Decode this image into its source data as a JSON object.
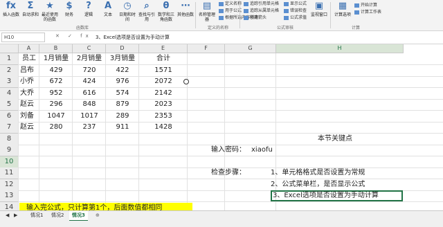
{
  "ribbon": {
    "buttons": [
      {
        "icon": "insert-function-icon",
        "glyph": "fx",
        "label": "插入函数"
      },
      {
        "icon": "autosum-icon",
        "glyph": "Σ",
        "label": "自动求和"
      },
      {
        "icon": "recent-functions-icon",
        "glyph": "★",
        "label": "最近使用的函数"
      },
      {
        "icon": "financial-icon",
        "glyph": "$",
        "label": "财务"
      },
      {
        "icon": "logical-icon",
        "glyph": "?",
        "label": "逻辑"
      },
      {
        "icon": "text-icon",
        "glyph": "A",
        "label": "文本"
      },
      {
        "icon": "date-time-icon",
        "glyph": "◷",
        "label": "日期和时间"
      },
      {
        "icon": "lookup-icon",
        "glyph": "⌕",
        "label": "查找与引用"
      },
      {
        "icon": "math-trig-icon",
        "glyph": "θ",
        "label": "数学和三角函数"
      },
      {
        "icon": "more-functions-icon",
        "glyph": "⋯",
        "label": "其他函数"
      },
      {
        "icon": "name-manager-icon",
        "glyph": "▤",
        "label": "名称管理器"
      }
    ],
    "defined_names": [
      "定义名称",
      "用于公式",
      "根据所选内容创建"
    ],
    "auditing": [
      "追踪引用单元格",
      "追踪从属单元格",
      "移去箭头",
      "显示公式",
      "错误检查",
      "公式求值"
    ],
    "watch_label": "监视窗口",
    "calc_options_label": "计算选项",
    "calc_now": "开始计算",
    "calc_sheet": "计算工作表",
    "group_labels": [
      "函数库",
      "定义的名称",
      "公式审核",
      "计算"
    ]
  },
  "formula_bar": {
    "name_box": "H10",
    "content": "3、Excel选项是否设置为手动计算"
  },
  "columns": [
    "A",
    "B",
    "C",
    "D",
    "E",
    "F",
    "G",
    "H"
  ],
  "rows": [
    "1",
    "2",
    "3",
    "4",
    "5",
    "6",
    "7",
    "8",
    "9",
    "10",
    "11",
    "12",
    "13",
    "14"
  ],
  "table": {
    "headers": [
      "员工",
      "1月销量",
      "2月销量",
      "3月销量",
      "合计"
    ],
    "data": [
      [
        "吕布",
        "429",
        "720",
        "422",
        "1571"
      ],
      [
        "小乔",
        "672",
        "424",
        "976",
        "2072"
      ],
      [
        "大乔",
        "952",
        "616",
        "574",
        "2142"
      ],
      [
        "赵云",
        "296",
        "848",
        "879",
        "2023"
      ],
      [
        "刘备",
        "1047",
        "1017",
        "289",
        "2353"
      ],
      [
        "赵云",
        "280",
        "237",
        "911",
        "1428"
      ]
    ]
  },
  "notes": {
    "title": "本节关键点",
    "pwd_label": "输入密码：",
    "pwd_value": "xiaofu",
    "check_label": "检查步骤：",
    "step1": "1、单元格格式是否设置为常规",
    "step2": "2、公式菜单栏，是否显示公式",
    "step3": "3、Excel选项是否设置为手动计算",
    "highlight": "输入完公式，只计算第1个，后面数值都相同"
  },
  "sheets": [
    "情况1",
    "情况2",
    "情况3"
  ],
  "active_sheet": 2,
  "colors": {
    "highlight": "#ffff00",
    "active_tab": "#1e7145",
    "selection": "#217346"
  }
}
